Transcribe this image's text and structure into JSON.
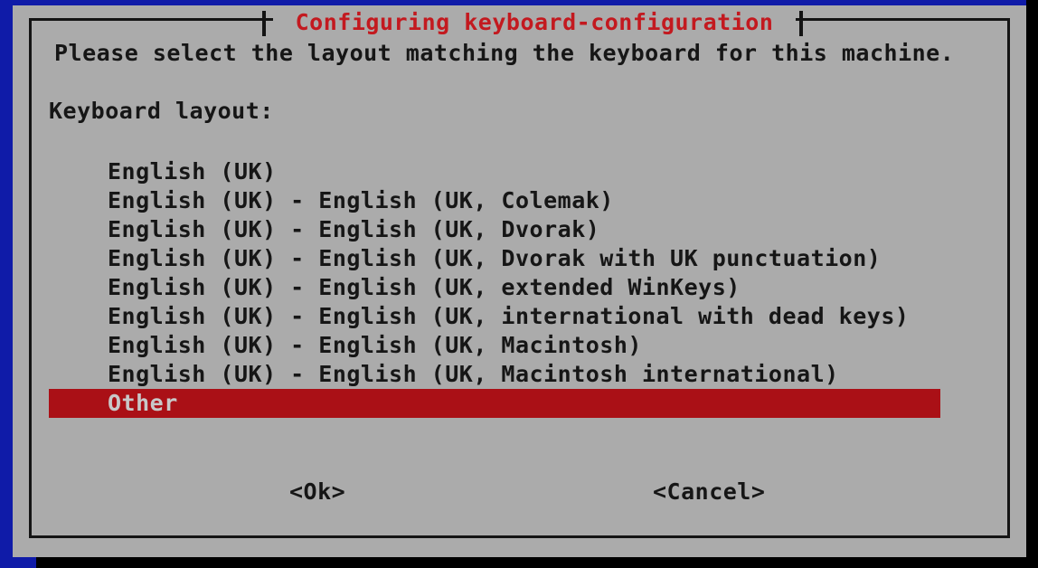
{
  "dialog": {
    "title": "Configuring keyboard-configuration",
    "prompt": "Please select the layout matching the keyboard for this machine.",
    "field_label": "Keyboard layout:",
    "choices": [
      {
        "label": "English (UK)",
        "selected": false
      },
      {
        "label": "English (UK) - English (UK, Colemak)",
        "selected": false
      },
      {
        "label": "English (UK) - English (UK, Dvorak)",
        "selected": false
      },
      {
        "label": "English (UK) - English (UK, Dvorak with UK punctuation)",
        "selected": false
      },
      {
        "label": "English (UK) - English (UK, extended WinKeys)",
        "selected": false
      },
      {
        "label": "English (UK) - English (UK, international with dead keys)",
        "selected": false
      },
      {
        "label": "English (UK) - English (UK, Macintosh)",
        "selected": false
      },
      {
        "label": "English (UK) - English (UK, Macintosh international)",
        "selected": false
      },
      {
        "label": "Other",
        "selected": true
      }
    ],
    "buttons": {
      "ok": "<Ok>",
      "cancel": "<Cancel>"
    },
    "colors": {
      "screen_background": "#0f1ba8",
      "dialog_background": "#ababab",
      "border": "#141414",
      "title_text": "#c3191f",
      "body_text": "#161616",
      "selection_background": "#aa1016",
      "selection_text": "#c8c8c8",
      "console_black": "#000000"
    }
  }
}
